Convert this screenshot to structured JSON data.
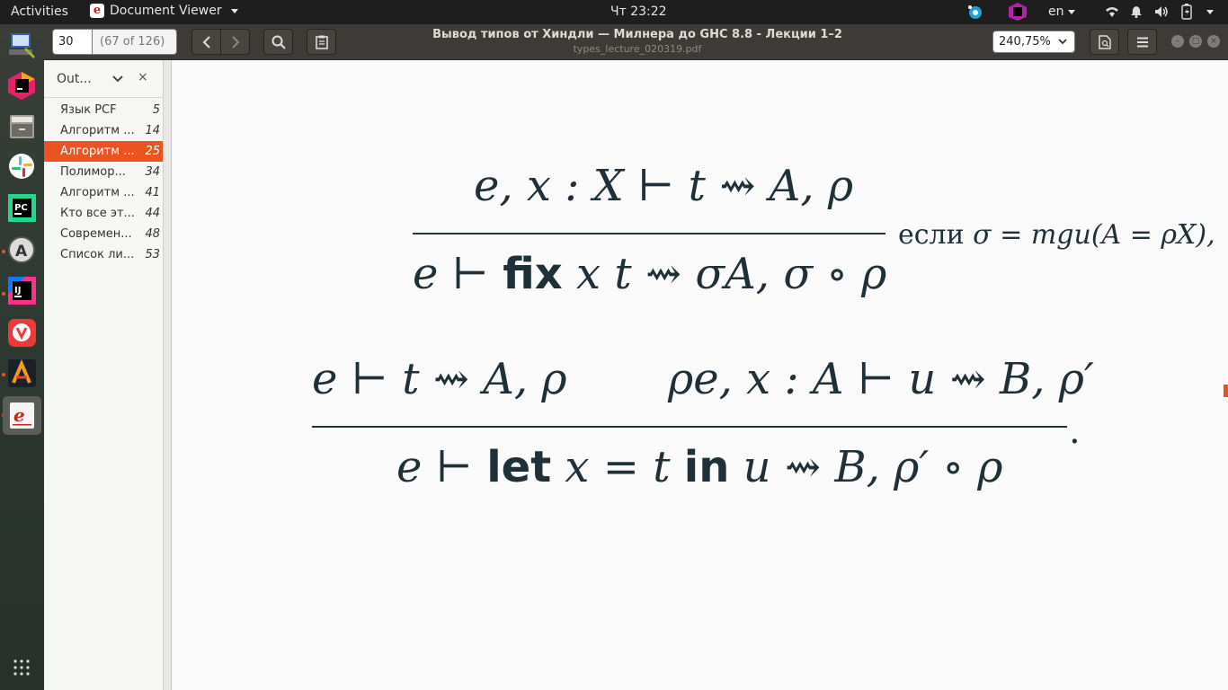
{
  "topbar": {
    "activities": "Activities",
    "app_name": "Document Viewer",
    "clock": "Чт 23:22",
    "lang": "en"
  },
  "dock": {
    "apps": [
      "terminal-app",
      "jetbrains-toolbox",
      "files-app",
      "slack-app",
      "pycharm-app",
      "software-updater-app",
      "intellij-app",
      "vivaldi-app",
      "affine-app",
      "document-viewer-app"
    ],
    "show_apps_icon": "grid-icon"
  },
  "header": {
    "page_entry": "30",
    "page_count": "(67 of 126)",
    "title": "Вывод типов от Хиндли — Милнера до GHC 8.8 - Лекции 1–2",
    "subtitle": "types_lecture_020319.pdf",
    "zoom": "240,75%"
  },
  "sidebar": {
    "title": "Out...",
    "items": [
      {
        "label": "Язык PCF",
        "page": "5"
      },
      {
        "label": "Алгоритм ...",
        "page": "14"
      },
      {
        "label": "Алгоритм ...",
        "page": "25"
      },
      {
        "label": "Полимор...",
        "page": "34"
      },
      {
        "label": "Алгоритм ...",
        "page": "41"
      },
      {
        "label": "Кто все эт...",
        "page": "44"
      },
      {
        "label": "Современ...",
        "page": "48"
      },
      {
        "label": "Список ли...",
        "page": "53"
      }
    ],
    "selected_index": 2
  },
  "document": {
    "rule1_premise": "e, x : X ⊢ t ⇝ A,  ρ",
    "rule1_conclusion_e": "e ⊢",
    "rule1_conclusion_kw": "fix",
    "rule1_conclusion_rest": "x t ⇝ σA,  σ ∘ ρ",
    "rule1_side_word": "если",
    "rule1_side_formula": "σ = mgu(A = ρX),",
    "rule2_premise_left": "e ⊢ t ⇝ A,  ρ",
    "rule2_premise_right": "ρe, x : A ⊢ u ⇝ B,  ρ′",
    "rule2_conclusion_e": "e ⊢",
    "rule2_conclusion_kw1": "let",
    "rule2_conclusion_mid": "x = t",
    "rule2_conclusion_kw2": "in",
    "rule2_conclusion_rest": "u ⇝ B,  ρ′ ∘ ρ",
    "rule2_period": "."
  },
  "colors": {
    "accent": "#e95420",
    "topbar": "#1e1e1e",
    "headerbar": "#3c3b37",
    "formula": "#1f3038"
  }
}
